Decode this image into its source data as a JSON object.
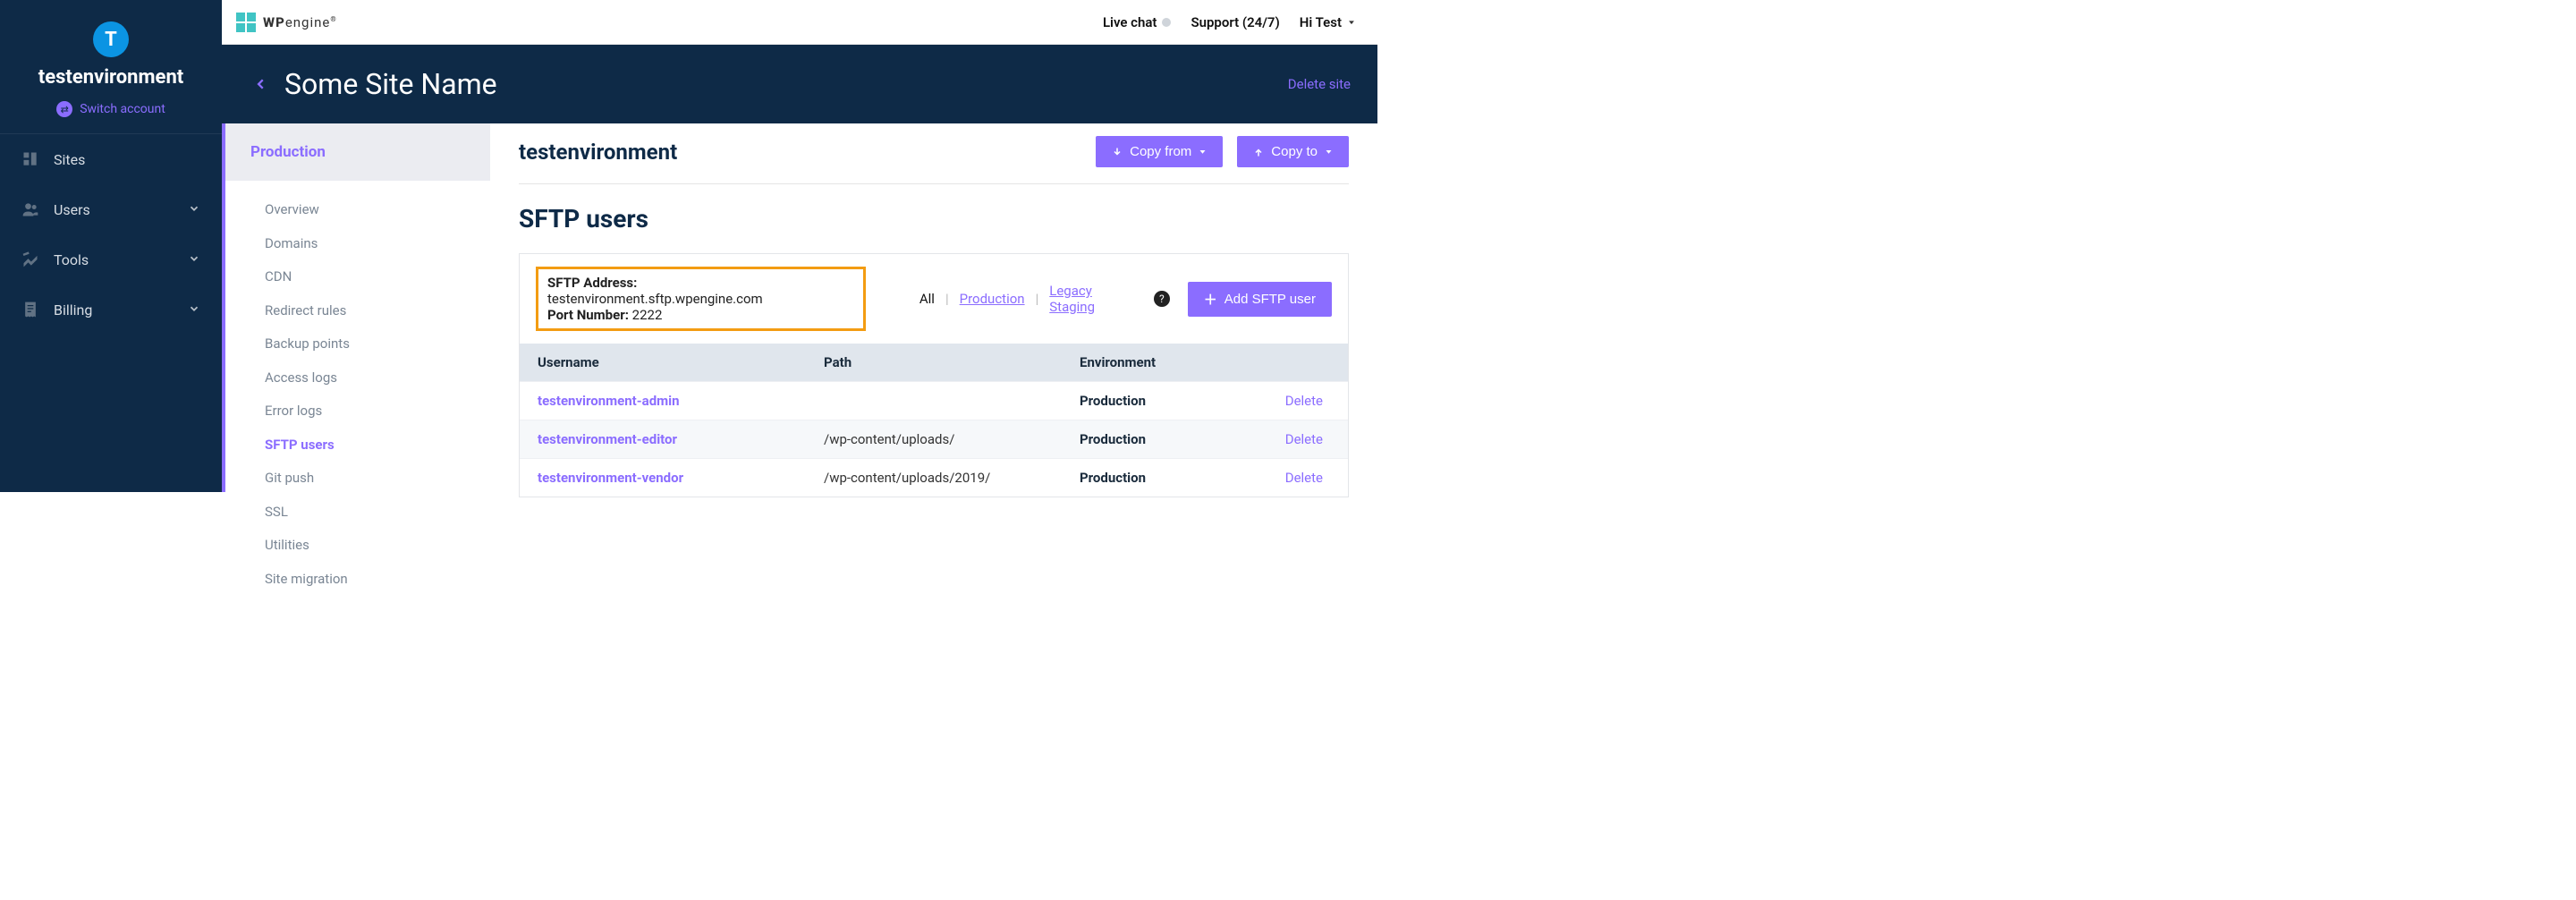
{
  "account": {
    "avatarLetter": "T",
    "name": "testenvironment",
    "switchLabel": "Switch account"
  },
  "leftNav": [
    {
      "label": "Sites",
      "icon": "grid",
      "hasChevron": false
    },
    {
      "label": "Users",
      "icon": "users",
      "hasChevron": true
    },
    {
      "label": "Tools",
      "icon": "tools",
      "hasChevron": true
    },
    {
      "label": "Billing",
      "icon": "receipt",
      "hasChevron": true
    }
  ],
  "topbar": {
    "brand": {
      "bold": "WP",
      "light": "engine"
    },
    "liveChat": "Live chat",
    "support": "Support (24/7)",
    "greeting": "Hi Test"
  },
  "siteHeader": {
    "title": "Some Site Name",
    "delete": "Delete site"
  },
  "subSidebar": {
    "envTab": "Production",
    "items": [
      "Overview",
      "Domains",
      "CDN",
      "Redirect rules",
      "Backup points",
      "Access logs",
      "Error logs",
      "SFTP users",
      "Git push",
      "SSL",
      "Utilities",
      "Site migration"
    ],
    "activeIndex": 7
  },
  "content": {
    "envName": "testenvironment",
    "copyFrom": "Copy from",
    "copyTo": "Copy to",
    "sectionTitle": "SFTP users",
    "sftp": {
      "addressLabel": "SFTP Address:",
      "addressValue": "testenvironment.sftp.wpengine.com",
      "portLabel": "Port Number:",
      "portValue": "2222"
    },
    "filters": {
      "all": "All",
      "production": "Production",
      "legacy": "Legacy Staging"
    },
    "addUser": "Add SFTP user",
    "table": {
      "headers": {
        "user": "Username",
        "path": "Path",
        "env": "Environment"
      },
      "deleteLabel": "Delete",
      "rows": [
        {
          "user": "testenvironment-admin",
          "path": "",
          "env": "Production"
        },
        {
          "user": "testenvironment-editor",
          "path": "/wp-content/uploads/",
          "env": "Production"
        },
        {
          "user": "testenvironment-vendor",
          "path": "/wp-content/uploads/2019/",
          "env": "Production"
        }
      ]
    }
  }
}
